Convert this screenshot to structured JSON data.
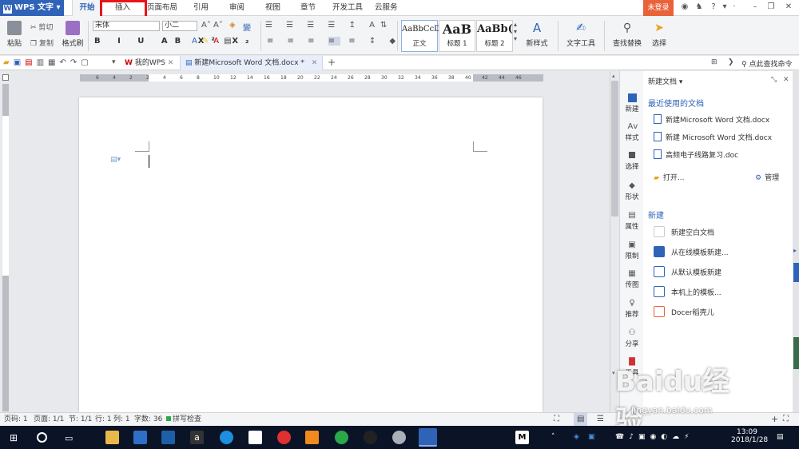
{
  "app": {
    "name": "WPS 文字",
    "login": "未登录"
  },
  "menu_tabs": [
    "开始",
    "插入",
    "页面布局",
    "引用",
    "审阅",
    "视图",
    "章节",
    "开发工具",
    "云服务"
  ],
  "ribbon": {
    "paste": "粘贴",
    "cut": "剪切",
    "copy": "复制",
    "format_painter": "格式刷",
    "font": "宋体",
    "font_size": "小二",
    "styles": [
      {
        "sample": "AaBbCcD",
        "label": "正文"
      },
      {
        "sample": "AaB",
        "label": "标题 1"
      },
      {
        "sample": "AaBb(",
        "label": "标题 2"
      }
    ],
    "new_style": "新样式",
    "text_tools": "文字工具",
    "find_replace": "查找替换",
    "select": "选择"
  },
  "qat": {
    "tab_mywps": "我的WPS",
    "tab_doc": "新建Microsoft Word 文档.docx *",
    "find_command": "点此查找命令"
  },
  "ruler_labels": [
    "6",
    "4",
    "2",
    "2",
    "4",
    "6",
    "8",
    "10",
    "12",
    "14",
    "16",
    "18",
    "20",
    "22",
    "24",
    "26",
    "28",
    "30",
    "32",
    "34",
    "36",
    "38",
    "40",
    "42",
    "44",
    "46"
  ],
  "side_nav": [
    "新建",
    "样式",
    "选择",
    "形状",
    "属性",
    "限制",
    "传图",
    "推荐",
    "分享",
    "工具"
  ],
  "pane": {
    "title": "新建文档",
    "recent_header": "最近使用的文档",
    "recent": [
      "新建Microsoft Word 文档.docx",
      "新建 Microsoft Word 文档.docx",
      "高频电子线路复习.doc"
    ],
    "open": "打开...",
    "manage": "管理",
    "new_header": "新建",
    "new_items": [
      "新建空白文档",
      "从在线模板新建...",
      "从默认模板新建",
      "本机上的模板...",
      "Docer稻壳儿"
    ]
  },
  "status": {
    "page_no": "页码: 1",
    "pages": "页面: 1/1",
    "section": "节: 1/1",
    "row": "行: 1",
    "col": "列: 1",
    "words": "字数: 36",
    "spell": "拼写检查"
  },
  "taskbar": {
    "time": "13:09",
    "date": "2018/1/28"
  },
  "watermark": {
    "brand": "Baidu经验",
    "url": "jingyan.baidu.com"
  },
  "colors": {
    "accent": "#2f63b8",
    "highlight_box": "#e8141a",
    "login": "#e8623a"
  }
}
